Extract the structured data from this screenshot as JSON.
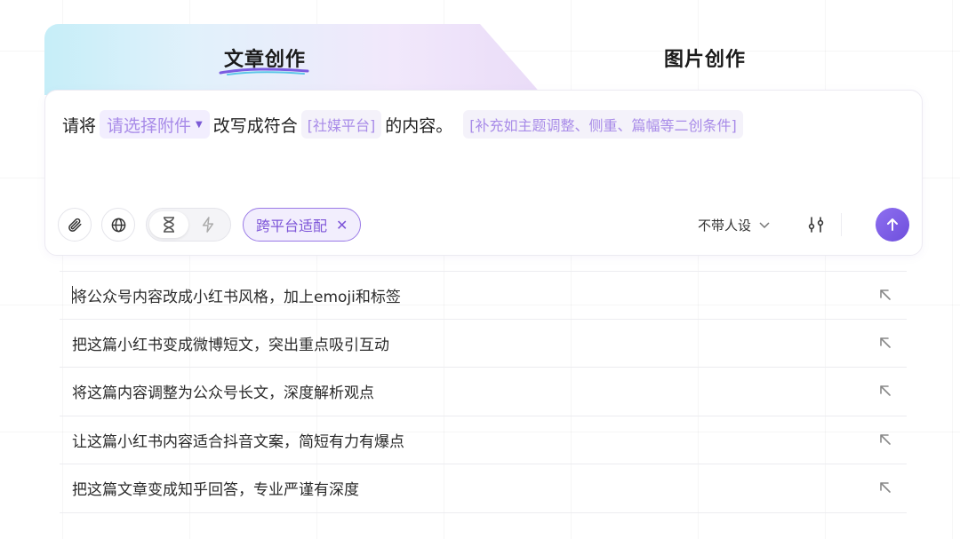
{
  "tabs": {
    "article": "文章创作",
    "image": "图片创作"
  },
  "prompt": {
    "prefix": "请将",
    "attachment_select": "请选择附件",
    "middle": "改写成符合",
    "platform_slot": "[社媒平台]",
    "suffix": "的内容。",
    "extra_slot": "[补充如主题调整、侧重、篇幅等二创条件]"
  },
  "toolbar": {
    "tag_label": "跨平台适配",
    "tag_remove": "✕",
    "persona_label": "不带人设"
  },
  "suggestions": [
    "将公众号内容改成小红书风格，加上emoji和标签",
    "把这篇小红书变成微博短文，突出重点吸引互动",
    "将这篇内容调整为公众号长文，深度解析观点",
    "让这篇小红书内容适合抖音文案，简短有力有爆点",
    "把这篇文章变成知乎回答，专业严谨有深度"
  ],
  "colors": {
    "accent": "#7d55d8",
    "chip_bg": "#f2eefe",
    "send_button": "#7a5ae4"
  },
  "icons": {
    "attach": "paperclip-icon",
    "globe": "globe-icon",
    "slow_mode": "hourglass-icon",
    "fast_mode": "lightning-icon",
    "persona_dropdown": "chevron-down-icon",
    "settings": "sliders-icon",
    "send": "arrow-up-icon",
    "fill_suggestion": "arrow-up-left-icon"
  }
}
